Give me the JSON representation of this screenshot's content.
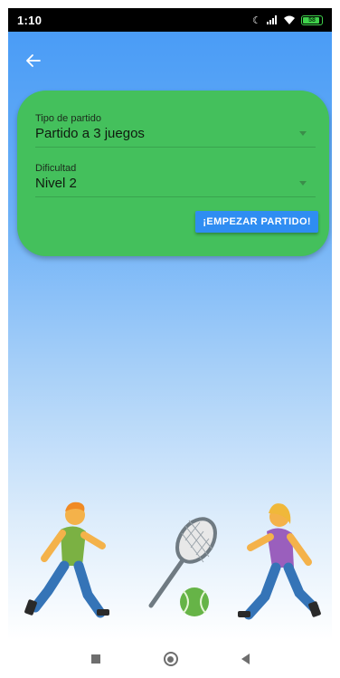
{
  "status_bar": {
    "time": "1:10",
    "battery": "58"
  },
  "header": {
    "back_icon": "arrow-left-icon"
  },
  "form": {
    "match_type_label": "Tipo de partido",
    "match_type_value": "Partido a 3 juegos",
    "difficulty_label": "Dificultad",
    "difficulty_value": "Nivel 2",
    "start_button_label": "¡EMPEZAR PARTIDO!"
  },
  "colors": {
    "card_green": "#44c05c",
    "button_blue": "#2f8df2",
    "sky_top": "#4a9cf6"
  },
  "illustration": {
    "icons": [
      "person-running-icon",
      "tennis-racket-icon",
      "tennis-ball-icon",
      "person-running-icon"
    ]
  },
  "nav_bar": {
    "icons": [
      "recent-apps-icon",
      "home-icon",
      "back-icon"
    ]
  }
}
